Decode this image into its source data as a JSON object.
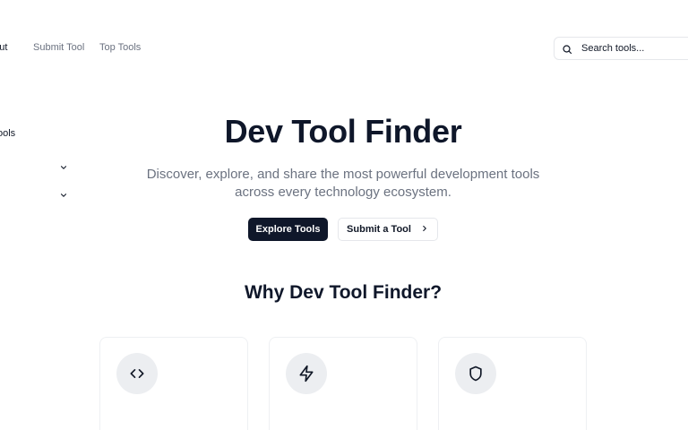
{
  "nav": {
    "links": [
      {
        "label": "About",
        "visible_label": "bout"
      },
      {
        "label": "Submit Tool"
      },
      {
        "label": "Top Tools"
      }
    ]
  },
  "search": {
    "placeholder": "Search tools...",
    "icon": "search-icon"
  },
  "sidebar": {
    "label": "Tools",
    "visible_label": "ools",
    "chevron_icon": "chevron-down-icon"
  },
  "hero": {
    "title": "Dev Tool Finder",
    "subtitle": "Discover, explore, and share the most powerful development tools across every technology ecosystem.",
    "primary_button": "Explore Tools",
    "secondary_button": "Submit a Tool",
    "secondary_icon": "chevron-right-icon"
  },
  "features": {
    "title": "Why Dev Tool Finder?",
    "cards": [
      {
        "icon": "code-icon"
      },
      {
        "icon": "zap-icon"
      },
      {
        "icon": "shield-icon"
      }
    ]
  },
  "colors": {
    "primary": "#0f172a",
    "muted_text": "#6b7280",
    "border": "#e5e7eb",
    "icon_bg": "#eceef1"
  }
}
